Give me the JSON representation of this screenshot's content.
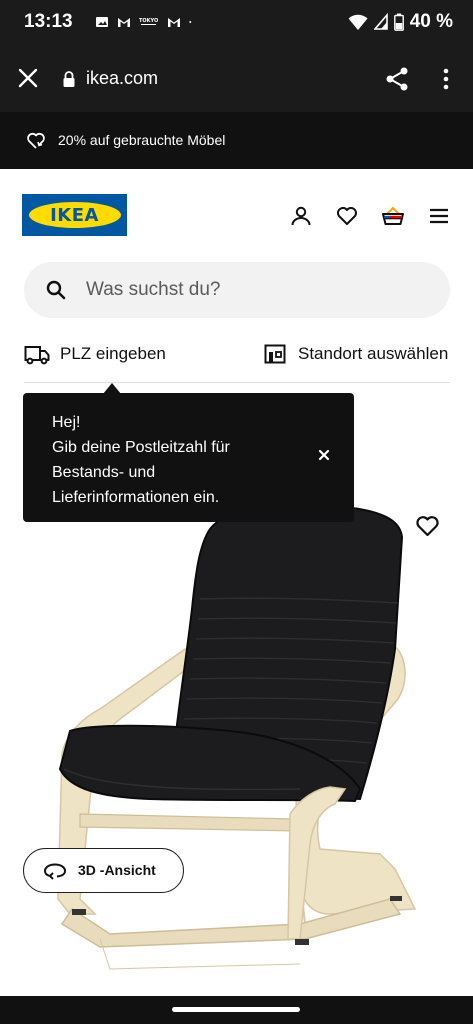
{
  "status": {
    "time": "13:13",
    "notification_icons": [
      "image-icon",
      "gmail-icon",
      "tokio-icon",
      "gmail-icon"
    ],
    "battery": "40 %"
  },
  "browser": {
    "url": "ikea.com"
  },
  "promo": {
    "text": "20% auf gebrauchte Möbel"
  },
  "header": {
    "logo": "IKEA"
  },
  "search": {
    "placeholder": "Was suchst du?"
  },
  "location": {
    "plz_label": "PLZ eingeben",
    "store_label": "Standort auswählen"
  },
  "tooltip": {
    "line1": "Hej!",
    "line2": "Gib deine Postleitzahl für",
    "line3": "Bestands- und",
    "line4": "Lieferinformationen ein."
  },
  "product": {
    "view_3d_label": "3D -Ansicht"
  },
  "colors": {
    "ikea_blue": "#0058a3",
    "ikea_yellow": "#ffdb00",
    "dark": "#111111"
  }
}
